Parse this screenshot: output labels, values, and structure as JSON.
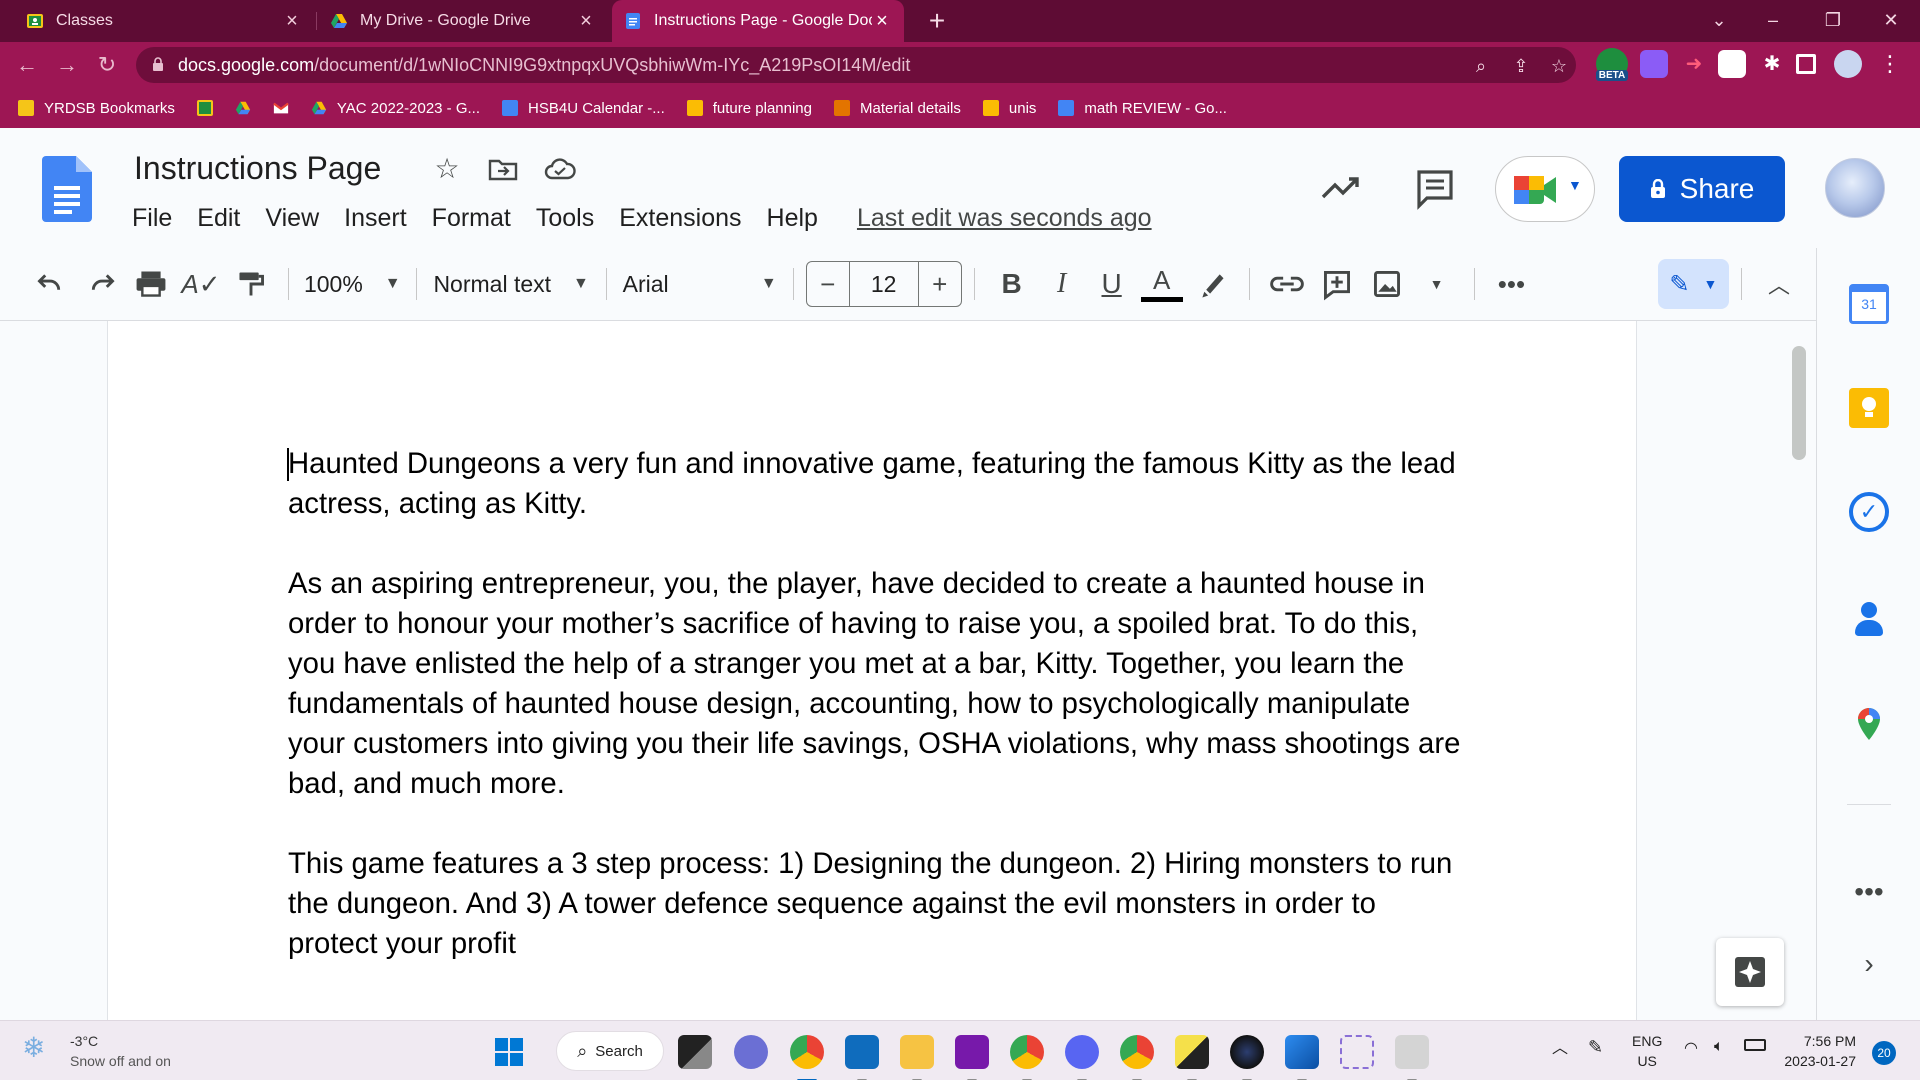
{
  "browser": {
    "tabs": [
      {
        "title": "Classes",
        "active": false
      },
      {
        "title": "My Drive - Google Drive",
        "active": false
      },
      {
        "title": "Instructions Page - Google Docs",
        "active": true
      }
    ],
    "url_host": "docs.google.com",
    "url_path": "/document/d/1wNIoCNNI9G9xtnpqxUVQsbhiwWm-IYc_A219PsOI14M/edit",
    "beta_badge": "BETA",
    "bookmarks": [
      {
        "label": "YRDSB Bookmarks",
        "icon": "folder-icon"
      },
      {
        "label": "",
        "icon": "classroom-icon"
      },
      {
        "label": "",
        "icon": "drive-icon"
      },
      {
        "label": "",
        "icon": "gmail-icon"
      },
      {
        "label": "YAC 2022-2023 - G...",
        "icon": "drive-icon"
      },
      {
        "label": "HSB4U Calendar -...",
        "icon": "docs-icon"
      },
      {
        "label": "future planning",
        "icon": "keep-icon"
      },
      {
        "label": "Material details",
        "icon": "classroom-icon"
      },
      {
        "label": "unis",
        "icon": "keep-icon"
      },
      {
        "label": "math REVIEW - Go...",
        "icon": "docs-icon"
      }
    ]
  },
  "docs": {
    "title": "Instructions Page",
    "menus": [
      "File",
      "Edit",
      "View",
      "Insert",
      "Format",
      "Tools",
      "Extensions",
      "Help"
    ],
    "last_edit": "Last edit was seconds ago",
    "share_label": "Share",
    "toolbar": {
      "zoom": "100%",
      "style": "Normal text",
      "font": "Arial",
      "font_size": "12",
      "minus": "−",
      "plus": "+"
    },
    "paragraphs": [
      "Haunted Dungeons a very fun and innovative game, featuring the famous Kitty as the lead actress, acting as Kitty.",
      "As an aspiring entrepreneur, you, the player, have decided to create a haunted house in order to honour your mother’s sacrifice of having to raise you, a spoiled brat. To do this, you have enlisted the help of a stranger you met at a bar, Kitty. Together, you learn the fundamentals of haunted house design, accounting, how to psychologically manipulate your customers into giving you their life savings, OSHA violations, why mass shootings are bad, and much more.",
      "This game features a 3 step process: 1) Designing the dungeon. 2) Hiring monsters to run the dungeon. And 3) A tower defence sequence against the evil monsters in order to protect your profit"
    ],
    "side_panel": {
      "calendar_day": "31"
    }
  },
  "taskbar": {
    "weather_temp": "-3°C",
    "weather_desc": "Snow off and on",
    "search_label": "Search",
    "lang_top": "ENG",
    "lang_bottom": "US",
    "time": "7:56 PM",
    "date": "2023-01-27",
    "notifications": "20"
  },
  "colors": {
    "chrome_frame": "#5e0c34",
    "chrome_toolbar": "#9d1654",
    "share_blue": "#0b57d0",
    "docs_bg": "#f9fbfd"
  }
}
